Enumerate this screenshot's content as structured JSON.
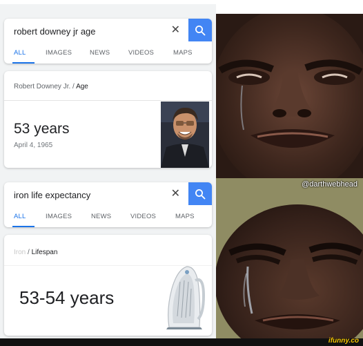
{
  "top_search": {
    "query": "robert downey jr age",
    "tabs": [
      "ALL",
      "IMAGES",
      "NEWS",
      "VIDEOS",
      "MAPS"
    ]
  },
  "top_result": {
    "entity": "Robert Downey Jr.",
    "separator": "/",
    "attribute": "Age",
    "value": "53 years",
    "subvalue": "April 4, 1965"
  },
  "bottom_search": {
    "query": "iron life expectancy",
    "tabs": [
      "ALL",
      "IMAGES",
      "NEWS",
      "VIDEOS",
      "MAPS"
    ]
  },
  "bottom_result": {
    "entity": "Iron",
    "separator": "/",
    "attribute": "Lifespan",
    "value": "53-54 years"
  },
  "meme": {
    "watermark": "@darthwebhead",
    "site": "ifunny.co"
  },
  "colors": {
    "accent": "#4285f4",
    "tab_active": "#1a73e8"
  }
}
